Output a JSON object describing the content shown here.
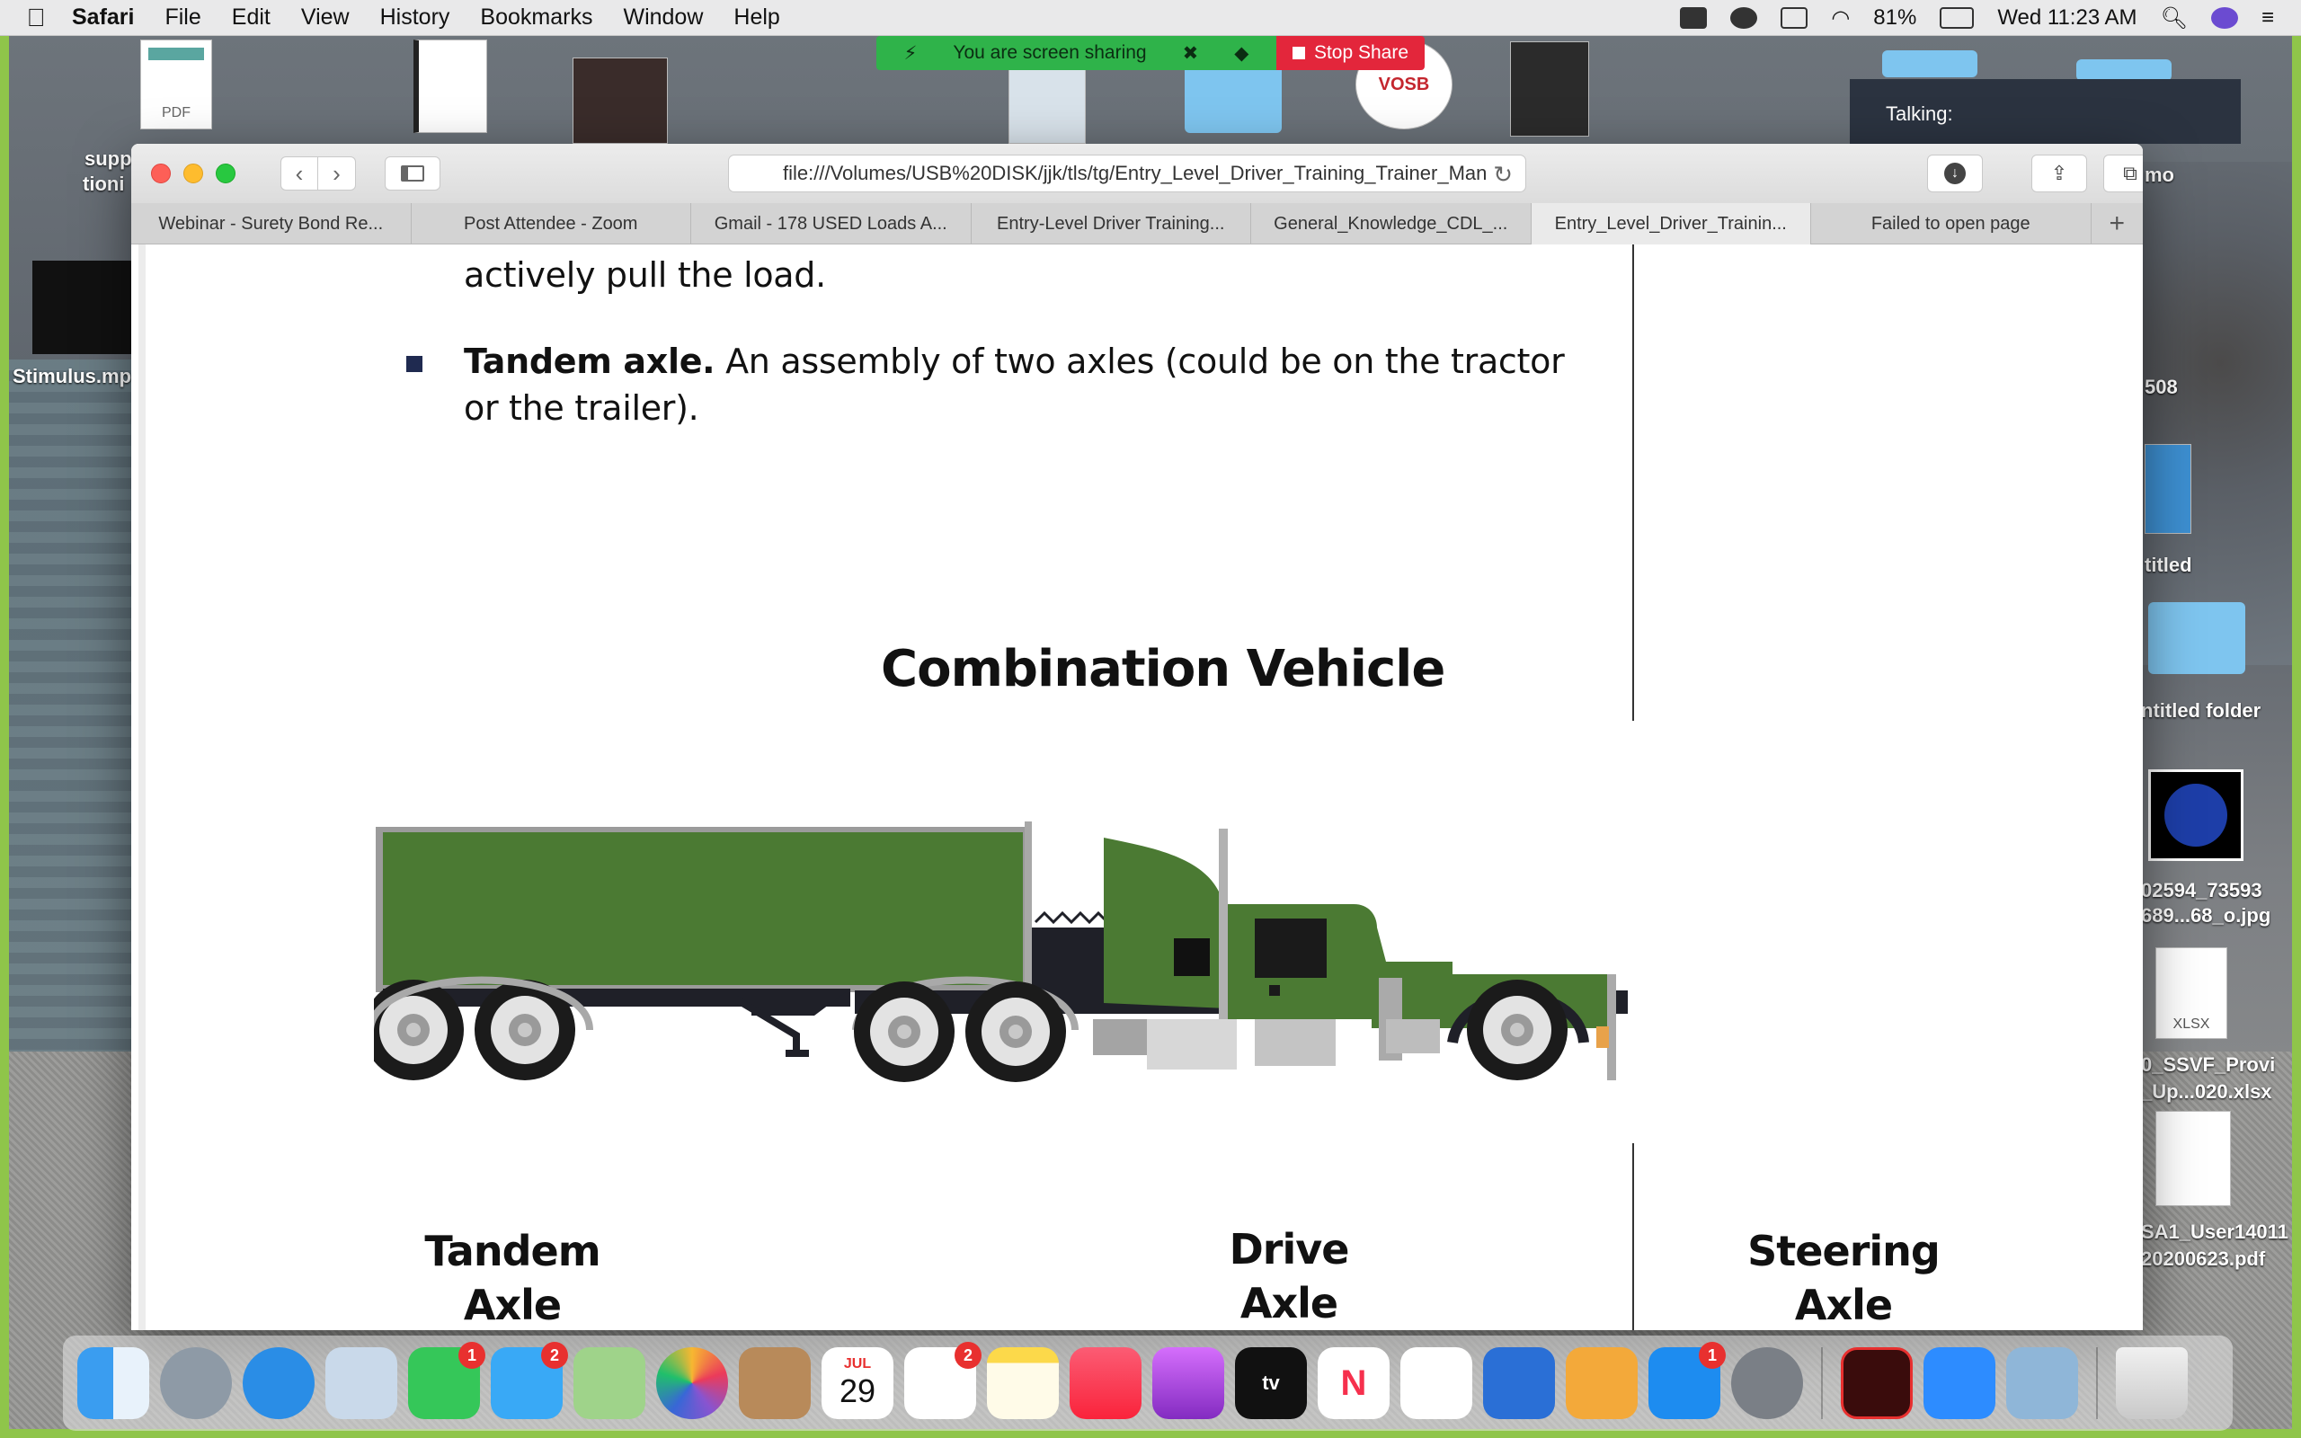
{
  "menubar": {
    "app": "Safari",
    "menus": [
      "File",
      "Edit",
      "View",
      "History",
      "Bookmarks",
      "Window",
      "Help"
    ],
    "battery": "81%",
    "clock": "Wed 11:23 AM"
  },
  "share": {
    "status": "You are screen sharing",
    "stop": "Stop Share"
  },
  "talking": "Talking:",
  "desktop": {
    "pdf_label": "PDF",
    "vosb": "VOSB",
    "left_labels": [
      "supp",
      "tioni",
      "Stimulus.mp"
    ],
    "right_labels": [
      "mo",
      "508",
      "titled",
      "ntitled folder",
      "02594_73593",
      "689...68_o.jpg",
      "XLSX",
      "0_SSVF_Provi",
      "_Up...020.xlsx",
      "SA1_User14011",
      "20200623.pdf"
    ]
  },
  "browser": {
    "url": "file:///Volumes/USB%20DISK/jjk/tls/tg/Entry_Level_Driver_Training_Trainer_Man",
    "tabs": [
      "Webinar - Surety Bond Re...",
      "Post Attendee - Zoom",
      "Gmail - 178 USED Loads A...",
      "Entry-Level Driver Training...",
      "General_Knowledge_CDL_...",
      "Entry_Level_Driver_Trainin...",
      "Failed to open page"
    ],
    "new_tab": "+"
  },
  "document": {
    "line1": "actively pull the load.",
    "bullet_term": "Tandem axle.",
    "bullet_text1": " An assembly of two axles (could be on the tractor",
    "bullet_text2": "or the trailer).",
    "figure_title": "Combination Vehicle",
    "labels": {
      "tandem1": "Tandem",
      "tandem2": "Axle",
      "drive1": "Drive",
      "drive2": "Axle",
      "steering1": "Steering",
      "steering2": "Axle"
    }
  },
  "dock": {
    "calendar_month": "JUL",
    "calendar_day": "29",
    "badges": {
      "facetime": "1",
      "messages": "2",
      "reminders": "2",
      "appstore": "1"
    },
    "tv": "tv"
  }
}
